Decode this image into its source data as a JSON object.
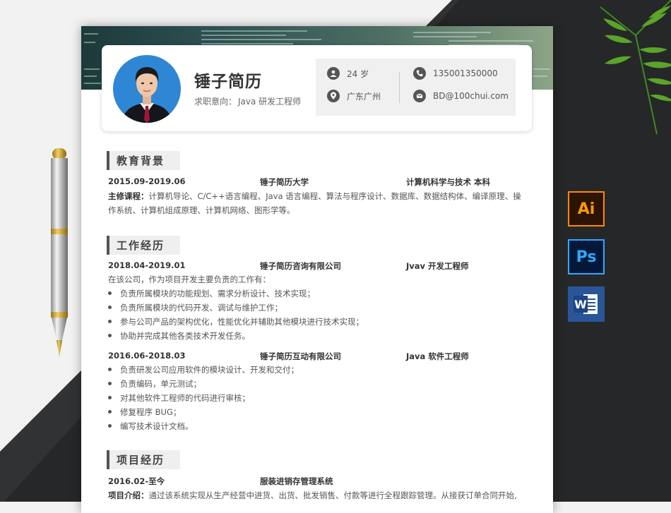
{
  "header": {
    "name": "锤子简历",
    "intent_label": "求职意向：",
    "intent_value": "Java 研发工程师",
    "age": "24 岁",
    "location": "广东广州",
    "phone": "135001350000",
    "email": "BD@100chui.com"
  },
  "education": {
    "title": "教育背景",
    "period": "2015.09-2019.06",
    "school": "锤子简历大学",
    "major": "计算机科学与技术  本科",
    "courses_label": "主修课程：",
    "courses": "计算机导论、C/C++语言编程、Java 语言编程、算法与程序设计、数据库、数据结构体、编译原理、操作系统、计算机组成原理、计算机网络、图形学等。"
  },
  "work": {
    "title": "工作经历",
    "jobs": [
      {
        "period": "2018.04-2019.01",
        "company": "锤子简历咨询有限公司",
        "position": "Jvav 开发工程师",
        "intro": "在该公司，作为项目开发主要负责的工作有：",
        "duties": [
          "负责所属模块的功能规划、需求分析设计、技术实现；",
          "负责所属模块的代码开发、调试与维护工作；",
          "参与公司产品的架构优化，性能优化并辅助其他模块进行技术实现；",
          "协助并完成其他各类技术开发任务。"
        ]
      },
      {
        "period": "2016.06-2018.03",
        "company": "锤子简历互动有限公司",
        "position": "Java 软件工程师",
        "duties": [
          "负责研发公司应用软件的模块设计、开发和交付；",
          "负责编码，单元测试；",
          "对其他软件工程师的代码进行审核；",
          "修复程序 BUG；",
          "编写技术设计文档。"
        ]
      }
    ]
  },
  "project": {
    "title": "项目经历",
    "period": "2016.02-至今",
    "name": "服装进销存管理系统",
    "intro_label": "项目介绍：",
    "intro": "通过该系统实现从生产经营中进货、出货、批发销售、付款等进行全程跟踪管理。从接获订单合同开始,"
  },
  "software": {
    "ai": "Ai",
    "ps": "Ps",
    "word": "W"
  },
  "colors": {
    "accent": "#555555",
    "photo_bg": "#2f86d4",
    "ai_orange": "#ff9a00",
    "ps_blue": "#31a8ff",
    "word_blue": "#2a5699"
  }
}
